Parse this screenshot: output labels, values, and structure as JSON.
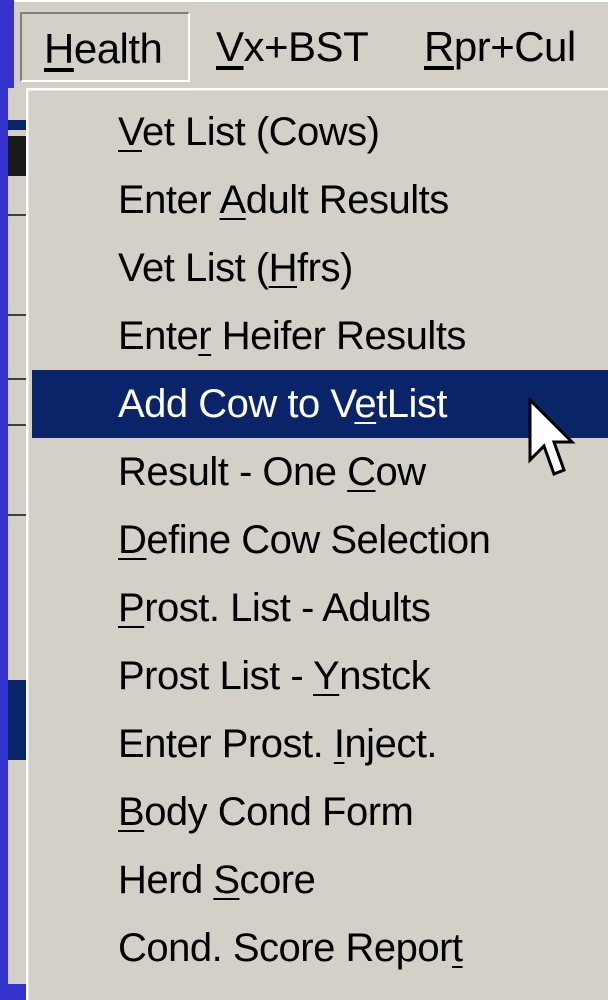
{
  "menubar": {
    "items": [
      {
        "pre": "",
        "key": "H",
        "post": "ealth"
      },
      {
        "pre": "",
        "key": "V",
        "post": "x+BST"
      },
      {
        "pre": "",
        "key": "R",
        "post": "pr+Cul"
      }
    ]
  },
  "menu": {
    "items": [
      {
        "pre": "",
        "key": "V",
        "post": "et List (Cows)"
      },
      {
        "pre": "Enter ",
        "key": "A",
        "post": "dult Results"
      },
      {
        "pre": "Vet List (",
        "key": "H",
        "post": "frs)"
      },
      {
        "pre": "Ente",
        "key": "r",
        "post": " Heifer Results"
      },
      {
        "pre": "Add Cow to V",
        "key": "e",
        "post": "tList"
      },
      {
        "pre": "Result - One ",
        "key": "C",
        "post": "ow"
      },
      {
        "pre": "",
        "key": "D",
        "post": "efine Cow Selection"
      },
      {
        "pre": "",
        "key": "P",
        "post": "rost. List - Adults"
      },
      {
        "pre": "Prost List - ",
        "key": "Y",
        "post": "nstck"
      },
      {
        "pre": "Enter Prost. ",
        "key": "I",
        "post": "nject."
      },
      {
        "pre": "",
        "key": "B",
        "post": "ody Cond Form"
      },
      {
        "pre": "Herd ",
        "key": "S",
        "post": "core"
      },
      {
        "pre": "Cond. Score Repor",
        "key": "t",
        "post": ""
      }
    ],
    "selected_index": 4
  },
  "colors": {
    "face": "#d4d0c8",
    "highlight": "#0a246a",
    "highlight_text": "#ffffff",
    "desktop": "#3333cc"
  },
  "cursor": {
    "icon": "arrow-cursor-icon"
  }
}
